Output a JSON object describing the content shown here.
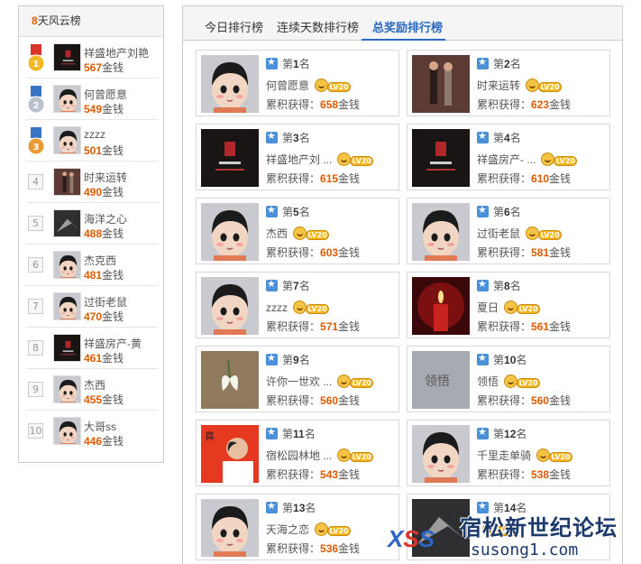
{
  "sidebar": {
    "title_num": "8",
    "title_text": "天风云榜",
    "items": [
      {
        "rank": "1",
        "name": "祥盛地产刘艳",
        "money": "567",
        "unit": "金钱",
        "avatar": "dark-logo"
      },
      {
        "rank": "2",
        "name": "何曾愿意",
        "money": "549",
        "unit": "金钱",
        "avatar": "cartoon"
      },
      {
        "rank": "3",
        "name": "zzzz",
        "money": "501",
        "unit": "金钱",
        "avatar": "cartoon"
      },
      {
        "rank": "4",
        "name": "时来运转",
        "money": "490",
        "unit": "金钱",
        "avatar": "photo"
      },
      {
        "rank": "5",
        "name": "海洋之心",
        "money": "488",
        "unit": "金钱",
        "avatar": "dark-gray"
      },
      {
        "rank": "6",
        "name": "杰克西",
        "money": "481",
        "unit": "金钱",
        "avatar": "cartoon"
      },
      {
        "rank": "7",
        "name": "过街老鼠",
        "money": "470",
        "unit": "金钱",
        "avatar": "cartoon"
      },
      {
        "rank": "8",
        "name": "祥盛房产-黄",
        "money": "461",
        "unit": "金钱",
        "avatar": "dark-logo"
      },
      {
        "rank": "9",
        "name": "杰西",
        "money": "455",
        "unit": "金钱",
        "avatar": "cartoon"
      },
      {
        "rank": "10",
        "name": "大哥ss",
        "money": "446",
        "unit": "金钱",
        "avatar": "cartoon"
      }
    ]
  },
  "tabs": [
    {
      "label": "今日排行榜",
      "active": false
    },
    {
      "label": "连续天数排行榜",
      "active": false
    },
    {
      "label": "总奖励排行榜",
      "active": true
    }
  ],
  "cards": [
    {
      "prefix": "第",
      "rank": "1",
      "suffix": "名",
      "name": "何曾愿意",
      "level": "LV20",
      "money_label": "累积获得：",
      "money": "658",
      "unit": "金钱",
      "avatar": "cartoon"
    },
    {
      "prefix": "第",
      "rank": "2",
      "suffix": "名",
      "name": "时来运转",
      "level": "LV20",
      "money_label": "累积获得：",
      "money": "623",
      "unit": "金钱",
      "avatar": "photo"
    },
    {
      "prefix": "第",
      "rank": "3",
      "suffix": "名",
      "name": "祥盛地产刘 ...",
      "level": "LV20",
      "money_label": "累积获得：",
      "money": "615",
      "unit": "金钱",
      "avatar": "dark-logo"
    },
    {
      "prefix": "第",
      "rank": "4",
      "suffix": "名",
      "name": "祥盛房产- ...",
      "level": "LV20",
      "money_label": "累积获得：",
      "money": "610",
      "unit": "金钱",
      "avatar": "dark-logo"
    },
    {
      "prefix": "第",
      "rank": "5",
      "suffix": "名",
      "name": "杰西",
      "level": "LV20",
      "money_label": "累积获得：",
      "money": "603",
      "unit": "金钱",
      "avatar": "cartoon"
    },
    {
      "prefix": "第",
      "rank": "6",
      "suffix": "名",
      "name": "过街老鼠",
      "level": "LV20",
      "money_label": "累积获得：",
      "money": "581",
      "unit": "金钱",
      "avatar": "cartoon"
    },
    {
      "prefix": "第",
      "rank": "7",
      "suffix": "名",
      "name": "zzzz",
      "level": "LV20",
      "money_label": "累积获得：",
      "money": "571",
      "unit": "金钱",
      "avatar": "cartoon"
    },
    {
      "prefix": "第",
      "rank": "8",
      "suffix": "名",
      "name": "夏日",
      "level": "LV20",
      "money_label": "累积获得：",
      "money": "561",
      "unit": "金钱",
      "avatar": "candle"
    },
    {
      "prefix": "第",
      "rank": "9",
      "suffix": "名",
      "name": "许你一世欢 ...",
      "level": "LV20",
      "money_label": "累积获得：",
      "money": "560",
      "unit": "金钱",
      "avatar": "flower"
    },
    {
      "prefix": "第",
      "rank": "10",
      "suffix": "名",
      "name": "领悟",
      "level": "LV20",
      "money_label": "累积获得：",
      "money": "560",
      "unit": "金钱",
      "avatar": "text-gray"
    },
    {
      "prefix": "第",
      "rank": "11",
      "suffix": "名",
      "name": "宿松园林地 ...",
      "level": "LV20",
      "money_label": "累积获得：",
      "money": "543",
      "unit": "金钱",
      "avatar": "red-person"
    },
    {
      "prefix": "第",
      "rank": "12",
      "suffix": "名",
      "name": "千里走单骑",
      "level": "LV20",
      "money_label": "累积获得：",
      "money": "538",
      "unit": "金钱",
      "avatar": "cartoon"
    },
    {
      "prefix": "第",
      "rank": "13",
      "suffix": "名",
      "name": "天海之恋",
      "level": "LV20",
      "money_label": "累积获得：",
      "money": "536",
      "unit": "金钱",
      "avatar": "cartoon"
    },
    {
      "prefix": "第",
      "rank": "14",
      "suffix": "名",
      "name": "",
      "level": "LV20",
      "money_label": "累积获得：",
      "money": "",
      "unit": "",
      "avatar": "dark-gray"
    }
  ],
  "watermark": {
    "title": "宿松新世纪论坛",
    "url": "susong1.com",
    "logo": "XSS"
  },
  "colors": {
    "accent": "#2b6cc2",
    "money": "#e05a00",
    "gold": "#f4b81e"
  }
}
